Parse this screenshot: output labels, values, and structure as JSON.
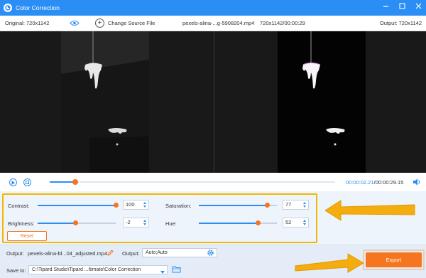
{
  "window": {
    "title": "Color Correction"
  },
  "info": {
    "original_label": "Original: 720x1142",
    "change_source": "Change Source File",
    "file_name": "pexels-alina-...g-5908204.mp4",
    "file_meta": "720x1142/00:00:29",
    "output_label": "Output: 720x1142"
  },
  "player": {
    "current_time": "00:00:02.21",
    "total_time": "/00:00:29.15",
    "progress": 0.09
  },
  "adjust": {
    "contrast": {
      "label": "Contrast:",
      "value": "100",
      "level": 1.0
    },
    "saturation": {
      "label": "Saturation:",
      "value": "77",
      "level": 0.88
    },
    "brightness": {
      "label": "Brightness:",
      "value": "-2",
      "level": 0.49
    },
    "hue": {
      "label": "Hue:",
      "value": "52",
      "level": 0.76
    },
    "reset_label": "Reset"
  },
  "output": {
    "label": "Output:",
    "file": "pexels-alina-bl...04_adjusted.mp4",
    "format_label": "Output:",
    "format_value": "Auto;Auto"
  },
  "save": {
    "label": "Save to:",
    "path": "C:\\Tipard Studio\\Tipard ...ltimate\\Color Correction"
  },
  "export_label": "Export",
  "colors": {
    "accent": "#2a8ef5",
    "orange": "#f5761f",
    "highlight": "#f0b800"
  }
}
